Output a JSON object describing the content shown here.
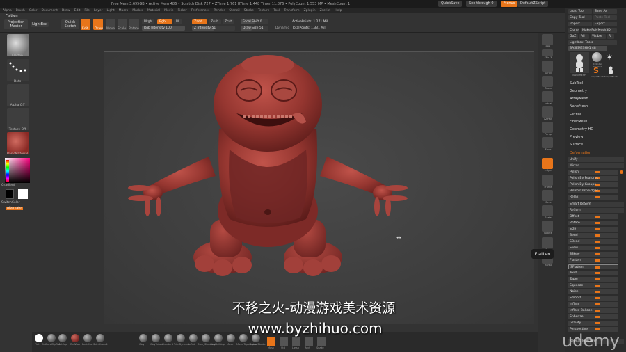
{
  "menubar": {
    "info": "Free Mem 3.695GB • Active Mem 486 • Scratch Disk 727 • ZTime 1.761 RTime 1.448 Timer 11.876 • PolyCount 1.553 MP • MeshCount 1",
    "quicksave": "QuickSave",
    "seethrough": "See-through 0",
    "menus": "Menus",
    "default_script": "DefaultZScript"
  },
  "menus": [
    "Alpha",
    "Brush",
    "Color",
    "Document",
    "Draw",
    "Edit",
    "File",
    "Layer",
    "Light",
    "Macro",
    "Marker",
    "Material",
    "Movie",
    "Picker",
    "Preferences",
    "Render",
    "Stencil",
    "Stroke",
    "Texture",
    "Tool",
    "Transform",
    "Zplugin",
    "Zscript",
    "Help"
  ],
  "toolbar": {
    "section": "Flatten",
    "projection_master": "Projection Master",
    "lightbox": "LightBox",
    "quick_sketch": "Quick Sketch",
    "edit": "Edit",
    "draw": "Draw",
    "move": "Move",
    "scale": "Scale",
    "rotate": "Rotate",
    "mrgb": "Mrgb",
    "rgb": "Rgb",
    "m": "M",
    "zadd": "Zadd",
    "zsub": "Zsub",
    "zcut": "Zcut",
    "rgb_intensity": "Rgb Intensity 100",
    "z_intensity": "Z Intensity 51",
    "focal_shift": "Focal Shift 0",
    "draw_size": "Draw Size 51",
    "dynamic": "Dynamic",
    "active_points": "ActivePoints: 1.271 Mil",
    "total_points": "TotalPoints: 1.331 Mil"
  },
  "left": {
    "brush_label": "Flatten",
    "stroke_label": "Dots",
    "alpha_label": "Alpha Off",
    "texture_label": "Texture Off",
    "material_label": "BasicMaterial",
    "gradient": "Gradient",
    "switch_color": "SwitchColor",
    "alternate": "Alternate"
  },
  "canvas": {
    "flatten_tooltip": "Flatten",
    "watermark": "不移之火-动漫游戏美术资源",
    "watermark_url": "www.byzhihuo.com",
    "udemy": "udemy"
  },
  "shelf_brushes": [
    "Flat",
    "CatFaceClipRot",
    "MatCap",
    "RedWax",
    "BasicMa",
    "SkinShade4",
    "Clay",
    "ClayTubes",
    "Standard",
    "TrimDynamic",
    "Inflat",
    "Dam_Standard",
    "ClayBuildup",
    "Move",
    "Move Topological",
    "Move Elastic",
    "Pinch",
    "Nudge",
    "Smooth",
    "hPolish"
  ],
  "shelf_icons": [
    "Mask",
    "Std",
    "Lasso",
    "Rect",
    "Snake"
  ],
  "right_shelf": [
    "BPR",
    "SPix 3",
    "Scroll",
    "Zoom",
    "Actual",
    "AAHalf",
    "Persp",
    "Floor",
    "L.Sym",
    "Frame",
    "Move",
    "Scale",
    "Rotate",
    "Solo",
    "Transp"
  ],
  "tray": {
    "load_tool": "Load Tool",
    "save_as": "Save As",
    "copy_tool": "Copy Tool",
    "paste_tool": "Paste Tool",
    "import": "Import",
    "export": "Export",
    "clone": "Clone",
    "make_polymesh": "Make PolyMesh3D",
    "goz": "GoZ",
    "all": "All",
    "visible": "Visible",
    "r": "R",
    "lightbox_tools": "Lightbox: Tools",
    "current_tool": "BASEMESH01 48",
    "tool_thumbs": [
      "BASEMESH",
      "Cylinder PolyMesh",
      "SimpleBrush",
      "SimpleBrush"
    ],
    "subpalettes": [
      "SubTool",
      "Geometry",
      "ArrayMesh",
      "NanoMesh",
      "Layers",
      "FiberMesh",
      "Geometry HD",
      "Preview",
      "Surface"
    ],
    "deformation": "Deformation",
    "deform_items": [
      "Unify",
      "Mirror",
      "Polish",
      "Polish By Features",
      "Polish By Groups",
      "Polish Crisp Edges",
      "Relax",
      "Smart ReSym",
      "ReSym",
      "Offset",
      "Rotate",
      "Size",
      "Bend",
      "SBend",
      "Skew",
      "SSkew",
      "Flatten",
      "SFlatten",
      "Twist",
      "Taper",
      "Squeeze",
      "Noise",
      "Smooth",
      "Inflate",
      "Inflate Balloon",
      "Spherize",
      "Gravity",
      "Perspective",
      "Repeat To Active"
    ]
  },
  "colors": {
    "accent": "#e8751a",
    "model": "#9a3a34",
    "bg": "#333333"
  }
}
